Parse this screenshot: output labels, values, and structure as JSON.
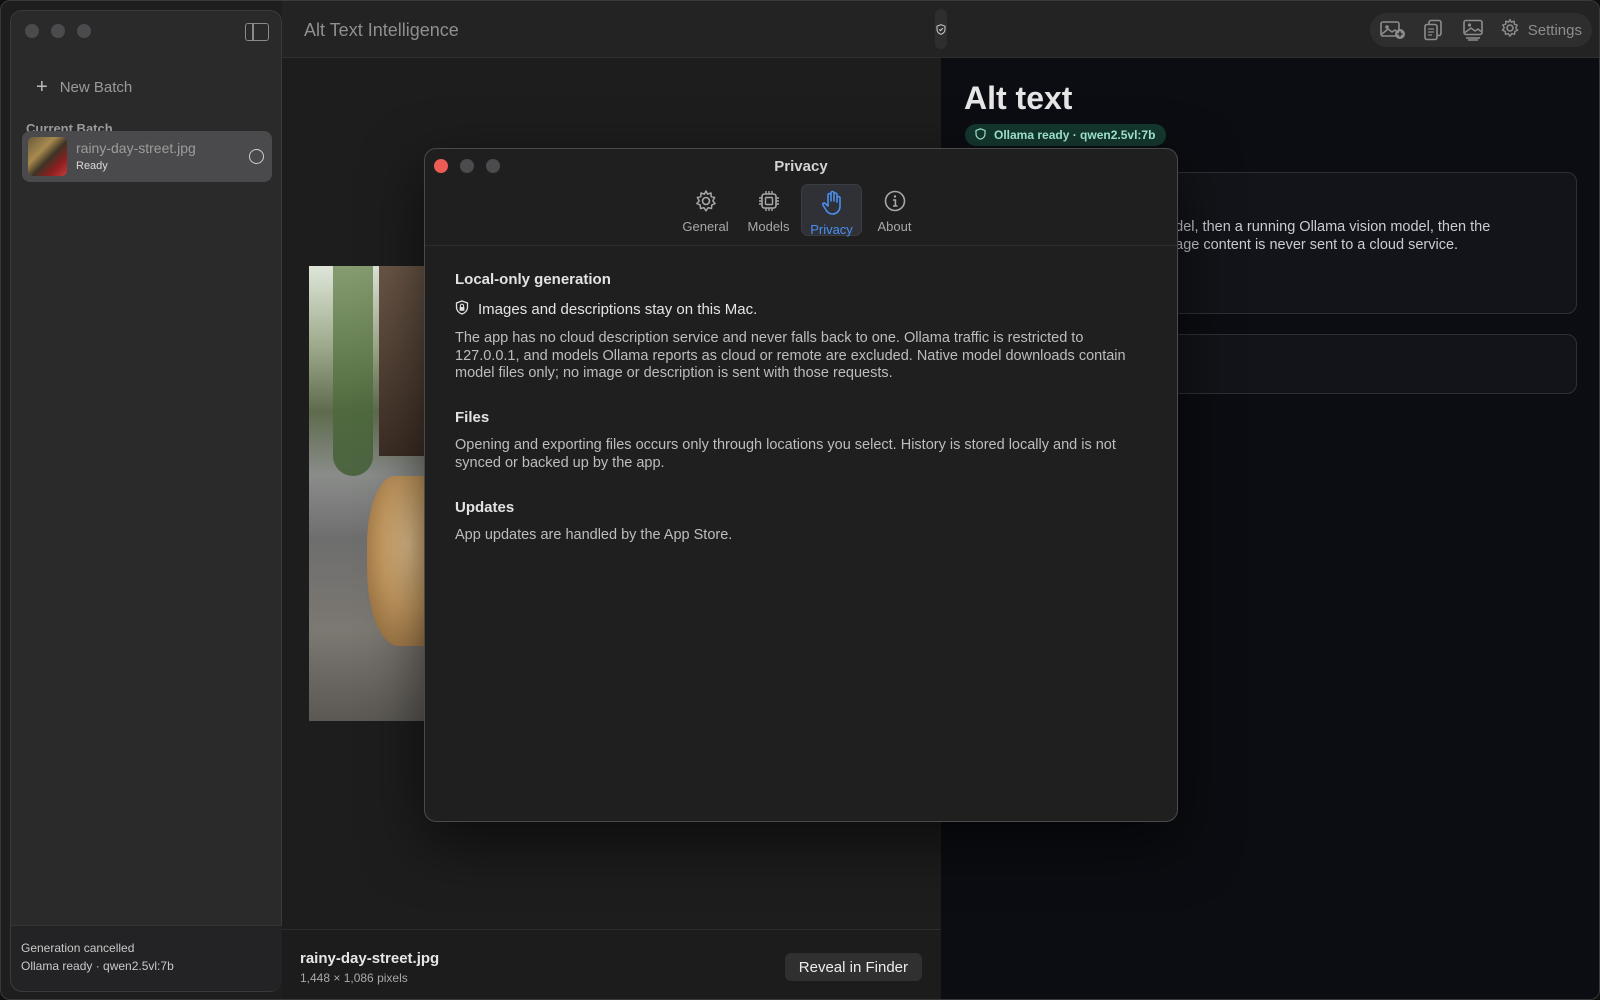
{
  "app": {
    "title": "Alt Text Intelligence"
  },
  "sidebar": {
    "new_batch_label": "New Batch",
    "section_label": "Current Batch",
    "items": [
      {
        "name": "rainy-day-street.jpg",
        "status": "Ready"
      }
    ],
    "footer": {
      "line1": "Generation cancelled",
      "line2": "Ollama ready · qwen2.5vl:7b"
    }
  },
  "toolbar": {
    "settings_label": "Settings",
    "icons": [
      "add-image-icon",
      "copy-icon",
      "image-icon",
      "gear-icon"
    ]
  },
  "preview": {
    "file_name": "rainy-day-street.jpg",
    "dimensions": "1,448 × 1,086 pixels",
    "reveal_label": "Reveal in Finder"
  },
  "right_panel": {
    "title": "Alt text",
    "status": "Ollama ready · qwen2.5vl:7b",
    "card_text_line1": "model, then a running Ollama vision model, then the",
    "card_text_line2": " Image content is never sent to a cloud service."
  },
  "dialog": {
    "title": "Privacy",
    "tabs": [
      {
        "label": "General"
      },
      {
        "label": "Models"
      },
      {
        "label": "Privacy"
      },
      {
        "label": "About"
      }
    ],
    "sections": {
      "local": {
        "title": "Local-only generation",
        "line": "Images and descriptions stay on this Mac.",
        "body": "The app has no cloud description service and never falls back to one. Ollama traffic is restricted to 127.0.0.1, and models Ollama reports as cloud or remote are excluded. Native model downloads contain model files only; no image or description is sent with those requests."
      },
      "files": {
        "title": "Files",
        "body": "Opening and exporting files occurs only through locations you select. History is stored locally and is not synced or backed up by the app."
      },
      "updates": {
        "title": "Updates",
        "body": "App updates are handled by the App Store."
      }
    }
  },
  "colors": {
    "accent": "#4a90f0",
    "status_green": "#a8f0d8",
    "close_red": "#ed5b55"
  }
}
